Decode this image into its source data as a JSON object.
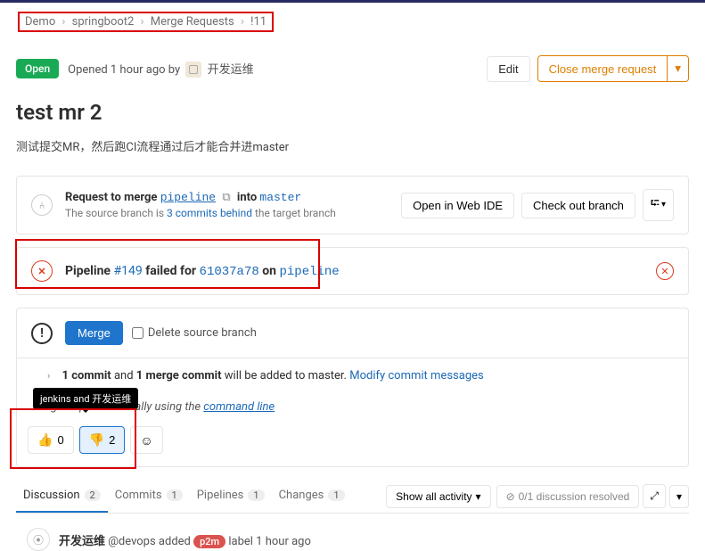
{
  "breadcrumb": {
    "i0": "Demo",
    "i1": "springboot2",
    "i2": "Merge Requests",
    "i3": "!11"
  },
  "header": {
    "status": "Open",
    "opened": "Opened 1 hour ago by",
    "user": "开发运维",
    "edit": "Edit",
    "close": "Close merge request"
  },
  "mr": {
    "title": "test mr 2",
    "desc": "测试提交MR，然后跑CI流程通过后才能合并进master"
  },
  "merge": {
    "l1a": "Request to merge ",
    "branch": "pipeline",
    "l1b": " into ",
    "target": "master",
    "l2a": "The source branch is ",
    "behind": "3 commits behind",
    "l2b": " the target branch",
    "openIde": "Open in Web IDE",
    "checkout": "Check out branch"
  },
  "pipeline": {
    "pre": "Pipeline ",
    "num": "#149",
    "mid": " failed for ",
    "hash": "61037a78",
    "on": " on ",
    "branch": "pipeline"
  },
  "mergeBtn": {
    "label": "Merge",
    "delete": "Delete source branch"
  },
  "commit": {
    "t1": "1 commit",
    "t2": " and ",
    "t3": "1 merge commit",
    "t4": " will be added to master. ",
    "link": "Modify commit messages"
  },
  "manual": {
    "t1": "rge request manually using the ",
    "link": "command line",
    "tooltip": "jenkins and 开发运维"
  },
  "reactions": {
    "up": "0",
    "down": "2"
  },
  "tabs": {
    "disc": "Discussion",
    "discN": "2",
    "comm": "Commits",
    "commN": "1",
    "pipe": "Pipelines",
    "pipeN": "1",
    "chng": "Changes",
    "chngN": "1",
    "activity": "Show all activity",
    "resolved": "0/1 discussion resolved"
  },
  "timeline": {
    "user": "开发运维",
    "handle": "@devops added",
    "label": "p2m",
    "after": "label 1 hour ago"
  }
}
